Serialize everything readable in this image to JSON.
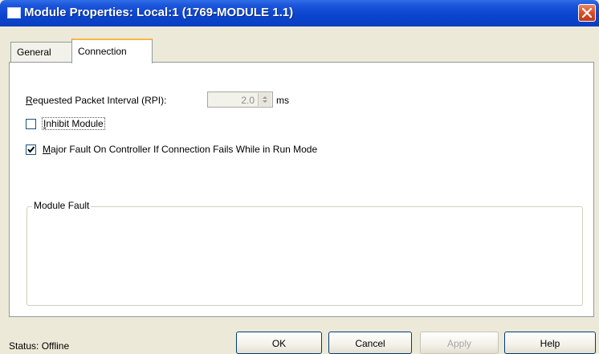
{
  "window": {
    "title": "Module Properties: Local:1 (1769-MODULE 1.1)"
  },
  "tabs": [
    {
      "label": "General",
      "active": false
    },
    {
      "label": "Connection",
      "active": true
    }
  ],
  "connection": {
    "rpi_label_mnemonic": "R",
    "rpi_label_rest": "equested Packet Interval (RPI):",
    "rpi_value": "2.0",
    "rpi_unit": "ms",
    "inhibit_mnemonic": "I",
    "inhibit_rest": "nhibit Module",
    "inhibit_checked": false,
    "major_fault_mnemonic": "M",
    "major_fault_rest": "ajor Fault On Controller If Connection Fails While in Run Mode",
    "major_fault_checked": true,
    "module_fault_label": "Module Fault"
  },
  "status": {
    "text": "Status:  Offline"
  },
  "buttons": {
    "ok": "OK",
    "cancel": "Cancel",
    "apply": "Apply",
    "help": "Help"
  },
  "icons": {
    "title": "window-icon",
    "close": "close-icon",
    "spin": "spinner-icon",
    "check": "check-icon"
  },
  "colors": {
    "titlebar": "#0a44cf",
    "close": "#d9532c",
    "active_tab_accent": "#f7b74a"
  }
}
